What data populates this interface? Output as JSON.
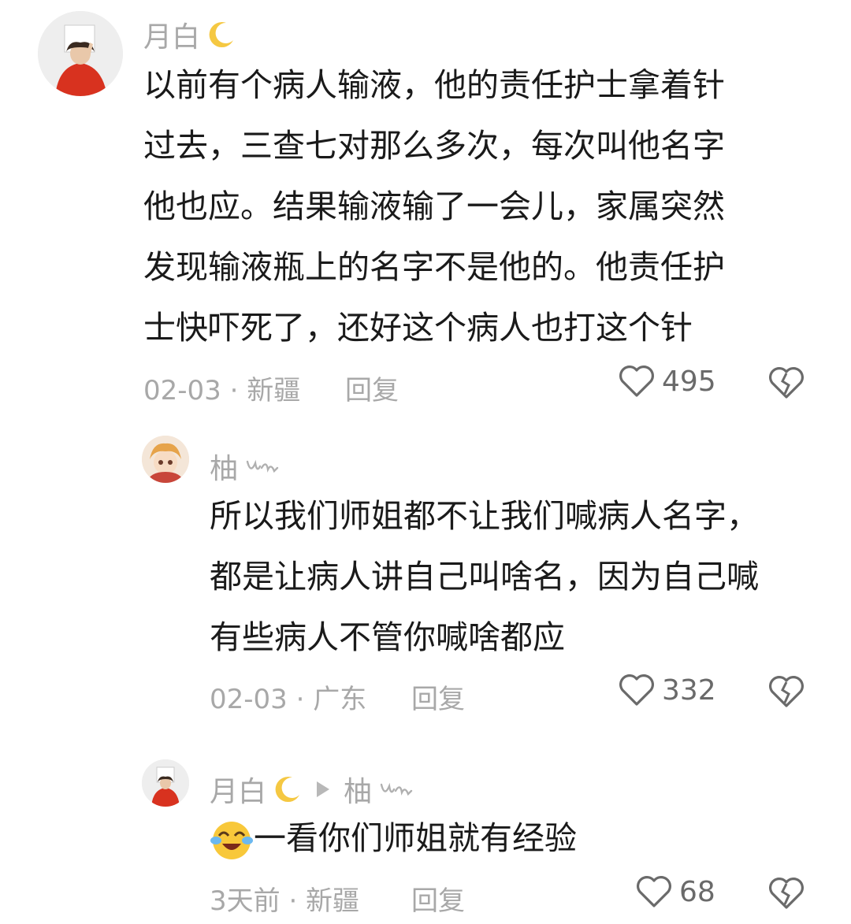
{
  "comments": [
    {
      "username": "月白",
      "lines": [
        "以前有个病人输液，他的责任护士拿着针",
        "过去，三查七对那么多次，每次叫他名字",
        "他也应。结果输液输了一会儿，家属突然",
        "发现输液瓶上的名字不是他的。他责任护",
        "士快吓死了，还好这个病人也打这个针"
      ],
      "time_location": "02-03 · 新疆",
      "reply_label": "回复",
      "likes": "495"
    },
    {
      "username": "柚",
      "lines": [
        "所以我们师姐都不让我们喊病人名字，",
        "都是让病人讲自己叫啥名，因为自己喊",
        "有些病人不管你喊啥都应"
      ],
      "time_location": "02-03 · 广东",
      "reply_label": "回复",
      "likes": "332"
    },
    {
      "username": "月白",
      "reply_to": "柚",
      "lines": [
        "一看你们师姐就有经验"
      ],
      "time_location": "3天前 · 新疆",
      "reply_label": "回复",
      "likes": "68"
    }
  ],
  "icons": {
    "moon": "crescent-moon-emoji",
    "signature": "handwritten-signature",
    "heart": "heart-outline-icon",
    "dislike": "broken-heart-icon",
    "emoji": "laughing-crying-emoji",
    "arrow": "reply-arrow-icon"
  },
  "colors": {
    "text": "#1a1a1a",
    "muted": "#a8a8a8",
    "moon": "#f5c842"
  }
}
